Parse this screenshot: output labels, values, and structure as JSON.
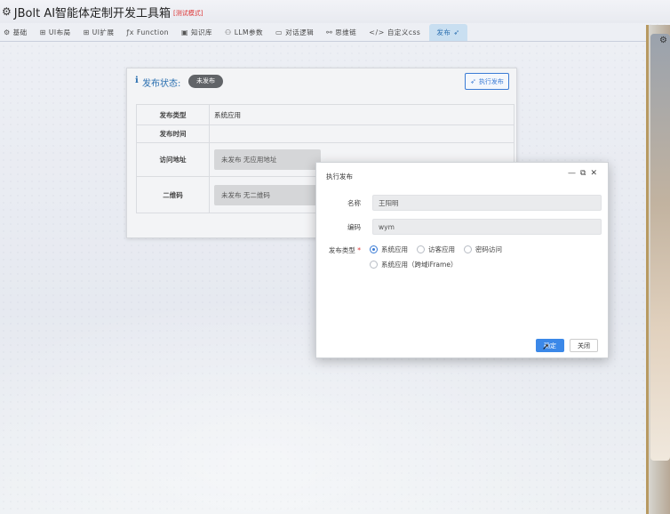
{
  "app": {
    "title": "JBolt AI智能体定制开发工具箱",
    "mode_badge": "[测试模式]"
  },
  "tabs": [
    {
      "icon": "gear-icon",
      "glyph": "⚙",
      "label": "基础"
    },
    {
      "icon": "grid-icon",
      "glyph": "⊞",
      "label": "UI布局"
    },
    {
      "icon": "grid-icon",
      "glyph": "⊞",
      "label": "UI扩展"
    },
    {
      "icon": "function-icon",
      "glyph": "ƒx",
      "label": "Function"
    },
    {
      "icon": "book-icon",
      "glyph": "▣",
      "label": "知识库"
    },
    {
      "icon": "llm-icon",
      "glyph": "⚇",
      "label": "LLM参数"
    },
    {
      "icon": "chat-icon",
      "glyph": "▭",
      "label": "对话逻辑"
    },
    {
      "icon": "mindmap-icon",
      "glyph": "⚯",
      "label": "思维链"
    },
    {
      "icon": "code-icon",
      "glyph": "</>",
      "label": "自定义css"
    },
    {
      "icon": "send-icon",
      "glyph": "➶",
      "label": "发布",
      "active": true
    }
  ],
  "publish_panel": {
    "status_label": "发布状态:",
    "status_value": "未发布",
    "execute_button": "执行发布",
    "rows": [
      {
        "key": "发布类型",
        "value": "系统应用"
      },
      {
        "key": "发布时间",
        "value": ""
      },
      {
        "key": "访问地址",
        "value": "未发布 无应用地址"
      },
      {
        "key": "二维码",
        "value": "未发布 无二维码"
      }
    ]
  },
  "modal": {
    "title": "执行发布",
    "name_label": "名称",
    "name_value": "王阳明",
    "code_label": "编码",
    "code_value": "wym",
    "type_label": "发布类型",
    "required_mark": "*",
    "options": [
      {
        "label": "系统应用",
        "checked": true
      },
      {
        "label": "访客应用",
        "checked": false
      },
      {
        "label": "密码访问",
        "checked": false
      },
      {
        "label": "系统应用（跨域iFrame）",
        "checked": false
      }
    ],
    "confirm_button": "确定",
    "close_button": "关闭"
  },
  "colors": {
    "accent": "#3a7bd5",
    "active_tab_bg": "#c9dff1",
    "status_badge_bg": "#616468",
    "mode_badge": "#dd3333"
  }
}
